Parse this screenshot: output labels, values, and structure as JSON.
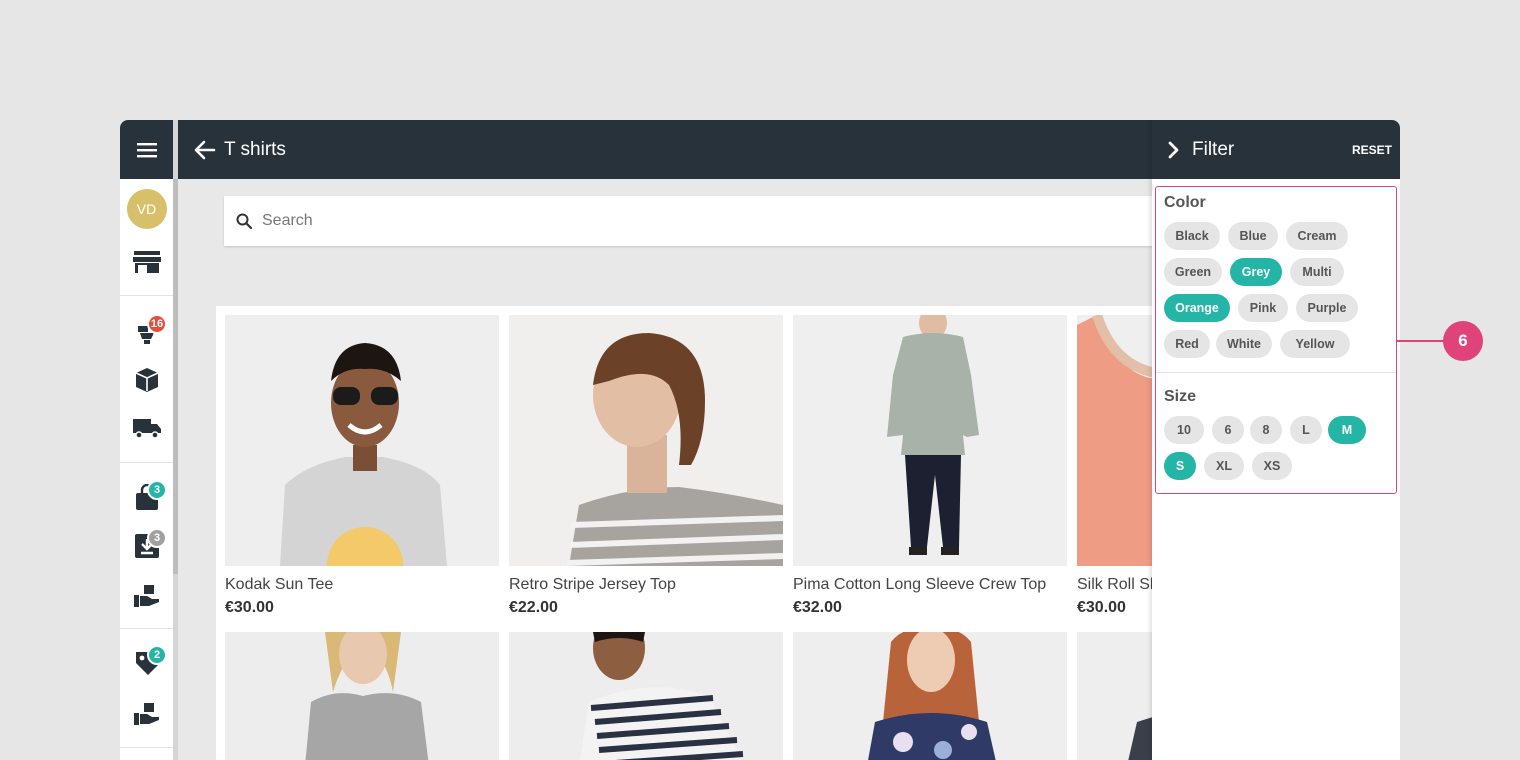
{
  "header": {
    "title": "T shirts"
  },
  "sidebar": {
    "avatar_initials": "VD",
    "badges": {
      "orders": "16",
      "bag": "3",
      "downloads": "3",
      "tags": "2"
    }
  },
  "search": {
    "placeholder": "Search"
  },
  "products": [
    {
      "name": "Kodak Sun Tee",
      "price": "€30.00"
    },
    {
      "name": "Retro Stripe Jersey Top",
      "price": "€22.00"
    },
    {
      "name": "Pima Cotton Long Sleeve Crew Top",
      "price": "€32.00"
    },
    {
      "name": "Silk Roll Sl",
      "price": "€30.00"
    }
  ],
  "filter": {
    "title": "Filter",
    "reset_label": "RESET",
    "color": {
      "title": "Color",
      "options": [
        {
          "label": "Black",
          "selected": false
        },
        {
          "label": "Blue",
          "selected": false
        },
        {
          "label": "Cream",
          "selected": false
        },
        {
          "label": "Green",
          "selected": false
        },
        {
          "label": "Grey",
          "selected": true
        },
        {
          "label": "Multi",
          "selected": false
        },
        {
          "label": "Orange",
          "selected": true
        },
        {
          "label": "Pink",
          "selected": false
        },
        {
          "label": "Purple",
          "selected": false
        },
        {
          "label": "Red",
          "selected": false
        },
        {
          "label": "White",
          "selected": false
        },
        {
          "label": "Yellow",
          "selected": false
        }
      ]
    },
    "size": {
      "title": "Size",
      "options": [
        {
          "label": "10",
          "selected": false
        },
        {
          "label": "6",
          "selected": false
        },
        {
          "label": "8",
          "selected": false
        },
        {
          "label": "L",
          "selected": false
        },
        {
          "label": "M",
          "selected": true
        },
        {
          "label": "S",
          "selected": true
        },
        {
          "label": "XL",
          "selected": false
        },
        {
          "label": "XS",
          "selected": false
        }
      ]
    }
  },
  "callout": {
    "number": "6"
  },
  "colors": {
    "header_bg": "#27323a",
    "accent": "#24b5a7",
    "highlight": "#e0427a",
    "badge_red": "#e84c3d"
  },
  "icons": [
    "menu-icon",
    "store-icon",
    "orders-icon",
    "box-icon",
    "truck-icon",
    "bag-icon",
    "download-icon",
    "hand-box-icon",
    "tag-icon",
    "arrow-back-icon",
    "chevron-right-icon",
    "search-icon"
  ]
}
